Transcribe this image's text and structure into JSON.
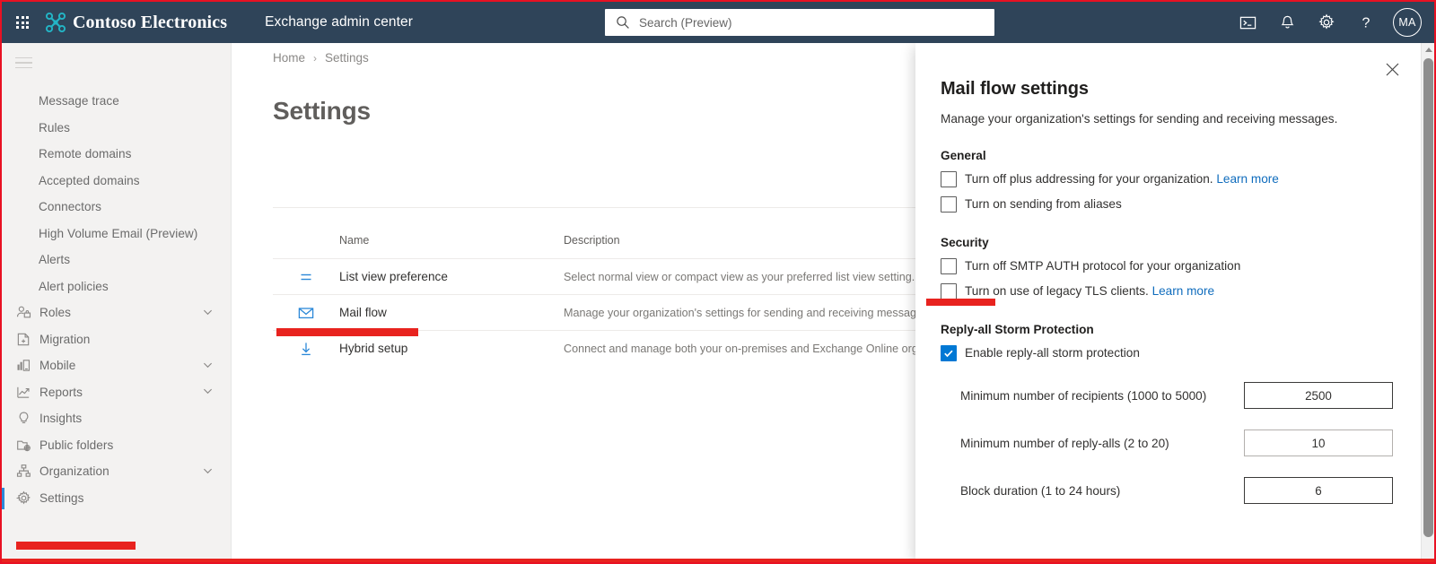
{
  "suite": {
    "waffle_label": "App launcher",
    "brand": "Contoso Electronics",
    "app_name": "Exchange admin center",
    "search_placeholder": "Search (Preview)",
    "search_value": "",
    "icons": [
      {
        "name": "cloud-shell-icon",
        "glyph": ">_"
      },
      {
        "name": "notifications-bell-icon",
        "glyph": "bell"
      },
      {
        "name": "settings-gear-icon",
        "glyph": "gear"
      },
      {
        "name": "help-question-icon",
        "glyph": "?"
      }
    ],
    "avatar_initials": "MA",
    "bar_color": "#2f4459",
    "accent_color": "#0078d4"
  },
  "sidebar": {
    "items": [
      {
        "label": "Message trace",
        "icon": "none",
        "sub": true,
        "chevron": false,
        "selected": false
      },
      {
        "label": "Rules",
        "icon": "none",
        "sub": true,
        "chevron": false,
        "selected": false
      },
      {
        "label": "Remote domains",
        "icon": "none",
        "sub": true,
        "chevron": false,
        "selected": false
      },
      {
        "label": "Accepted domains",
        "icon": "none",
        "sub": true,
        "chevron": false,
        "selected": false
      },
      {
        "label": "Connectors",
        "icon": "none",
        "sub": true,
        "chevron": false,
        "selected": false
      },
      {
        "label": "High Volume Email (Preview)",
        "icon": "none",
        "sub": true,
        "chevron": false,
        "selected": false
      },
      {
        "label": "Alerts",
        "icon": "none",
        "sub": true,
        "chevron": false,
        "selected": false
      },
      {
        "label": "Alert policies",
        "icon": "none",
        "sub": true,
        "chevron": false,
        "selected": false
      },
      {
        "label": "Roles",
        "icon": "roles-person-icon",
        "sub": false,
        "chevron": true,
        "selected": false
      },
      {
        "label": "Migration",
        "icon": "migration-icon",
        "sub": false,
        "chevron": false,
        "selected": false
      },
      {
        "label": "Mobile",
        "icon": "mobile-icon",
        "sub": false,
        "chevron": true,
        "selected": false
      },
      {
        "label": "Reports",
        "icon": "reports-chart-icon",
        "sub": false,
        "chevron": true,
        "selected": false
      },
      {
        "label": "Insights",
        "icon": "insights-lightbulb-icon",
        "sub": false,
        "chevron": false,
        "selected": false
      },
      {
        "label": "Public folders",
        "icon": "public-folders-icon",
        "sub": false,
        "chevron": false,
        "selected": false
      },
      {
        "label": "Organization",
        "icon": "organization-icon",
        "sub": false,
        "chevron": true,
        "selected": false
      },
      {
        "label": "Settings",
        "icon": "settings-gear-icon",
        "sub": false,
        "chevron": false,
        "selected": true
      }
    ]
  },
  "main": {
    "breadcrumb": [
      {
        "label": "Home"
      },
      {
        "label": "Settings"
      }
    ],
    "breadcrumb_sep": "›",
    "page_title": "Settings",
    "table": {
      "columns": [
        "Name",
        "Description"
      ],
      "rows": [
        {
          "icon": "list-view-icon",
          "name": "List view preference",
          "description": "Select normal view or compact view as your preferred list view setting."
        },
        {
          "icon": "mail-envelope-icon",
          "name": "Mail flow",
          "description": "Manage your organization's settings for sending and receiving messages"
        },
        {
          "icon": "hybrid-download-icon",
          "name": "Hybrid setup",
          "description": "Connect and manage both your on-premises and Exchange Online organizations"
        }
      ]
    }
  },
  "panel": {
    "title": "Mail flow settings",
    "description": "Manage your organization's settings for sending and receiving messages.",
    "close_label": "Close",
    "sections": [
      {
        "heading": "General",
        "checkboxes": [
          {
            "label": "Turn off plus addressing for your organization.",
            "link": "Learn more",
            "checked": false
          },
          {
            "label": "Turn on sending from aliases",
            "link": "",
            "checked": false
          }
        ]
      },
      {
        "heading": "Security",
        "checkboxes": [
          {
            "label": "Turn off SMTP AUTH protocol for your organization",
            "link": "",
            "checked": false
          },
          {
            "label": "Turn on use of legacy TLS clients.",
            "link": "Learn more",
            "checked": false
          }
        ]
      },
      {
        "heading": "Reply-all Storm Protection",
        "checkboxes": [
          {
            "label": "Enable reply-all storm protection",
            "link": "",
            "checked": true
          }
        ],
        "fields": [
          {
            "label": "Minimum number of recipients (1000 to 5000)",
            "value": "2500"
          },
          {
            "label": "Minimum number of reply-alls (2 to 20)",
            "value": "10"
          },
          {
            "label": "Block duration (1 to 24 hours)",
            "value": "6"
          }
        ]
      }
    ]
  },
  "annotations": {
    "highlight_color": "#e8231f",
    "marks": [
      "mail-flow-row-underline",
      "smtp-auth-checkbox-underline",
      "settings-nav-underline"
    ]
  }
}
